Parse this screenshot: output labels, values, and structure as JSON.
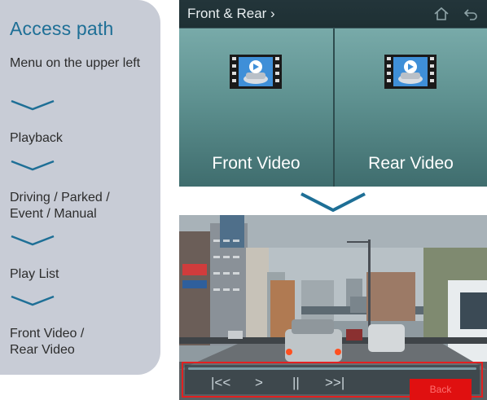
{
  "access": {
    "title": "Access path",
    "steps": [
      "Menu on the upper left",
      "Playback",
      "Driving / Parked / Event / Manual",
      "Play List",
      "Front Video / Rear Video"
    ]
  },
  "device": {
    "header_title": "Front & Rear",
    "header_chevron": "›",
    "icons": [
      "home-icon",
      "back-arrow-icon"
    ],
    "tiles": [
      {
        "label": "Front Video",
        "icon": "video-car-icon"
      },
      {
        "label": "Rear Video",
        "icon": "video-car-icon"
      }
    ]
  },
  "player": {
    "controls": {
      "rewind": "|<<",
      "play": ">",
      "pause": "||",
      "forward": ">>|",
      "back_label": "Back"
    }
  },
  "colors": {
    "accent_title": "#1e6f96",
    "card_bg": "#c8ccd6",
    "tile_teal": "#5e9190",
    "highlight_red": "#e32020"
  }
}
